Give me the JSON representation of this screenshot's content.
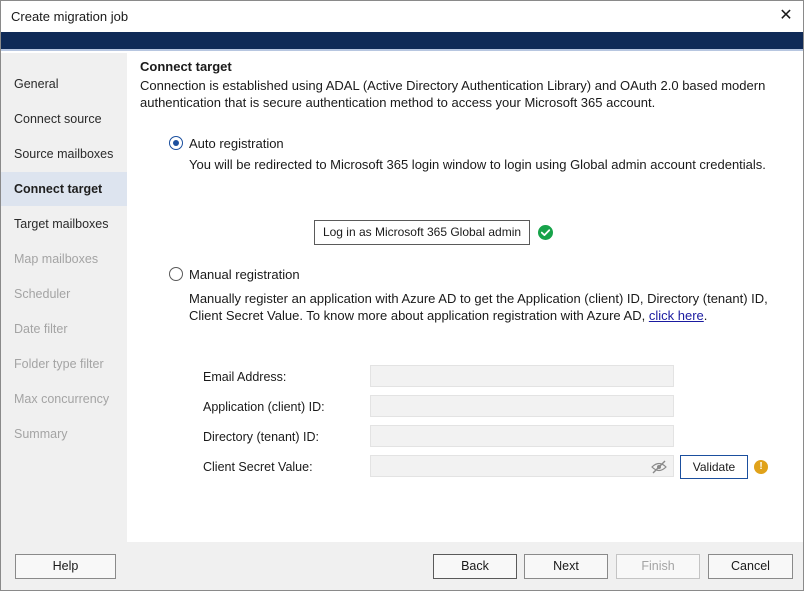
{
  "window": {
    "title": "Create migration job"
  },
  "sidebar": {
    "items": [
      {
        "label": "General",
        "state": "enabled"
      },
      {
        "label": "Connect source",
        "state": "enabled"
      },
      {
        "label": "Source mailboxes",
        "state": "enabled"
      },
      {
        "label": "Connect target",
        "state": "active"
      },
      {
        "label": "Target mailboxes",
        "state": "enabled"
      },
      {
        "label": "Map mailboxes",
        "state": "disabled"
      },
      {
        "label": "Scheduler",
        "state": "disabled"
      },
      {
        "label": "Date filter",
        "state": "disabled"
      },
      {
        "label": "Folder type filter",
        "state": "disabled"
      },
      {
        "label": "Max concurrency",
        "state": "disabled"
      },
      {
        "label": "Summary",
        "state": "disabled"
      }
    ]
  },
  "main": {
    "heading": "Connect target",
    "intro": "Connection is established using ADAL (Active Directory Authentication Library) and OAuth 2.0 based modern authentication that is secure authentication method to access your Microsoft 365 account.",
    "auto": {
      "label": "Auto registration",
      "selected": true,
      "description": "You will be redirected to Microsoft 365 login window to login using Global admin account credentials.",
      "login_button": "Log in as Microsoft 365 Global admin",
      "status_icon": "check-circle-icon"
    },
    "manual": {
      "label": "Manual registration",
      "selected": false,
      "description": "Manually register an application with Azure AD to get the Application (client) ID, Directory (tenant) ID, Client Secret Value. To know more about application registration with Azure AD,",
      "link_text": "click here",
      "link_suffix": "."
    },
    "fields": {
      "email_label": "Email Address:",
      "email_value": "",
      "app_id_label": "Application (client) ID:",
      "app_id_value": "",
      "tenant_id_label": "Directory (tenant) ID:",
      "tenant_id_value": "",
      "secret_label": "Client Secret Value:",
      "secret_value": ""
    },
    "validate_button": "Validate",
    "warning_icon": "warning-icon"
  },
  "footer": {
    "help": "Help",
    "back": "Back",
    "next": "Next",
    "finish": "Finish",
    "cancel": "Cancel"
  },
  "colors": {
    "banner": "#0f2a57",
    "accent": "#1b4f9e",
    "active_nav": "#dde4ef",
    "success": "#17a34a",
    "warning": "#e0a21a"
  }
}
